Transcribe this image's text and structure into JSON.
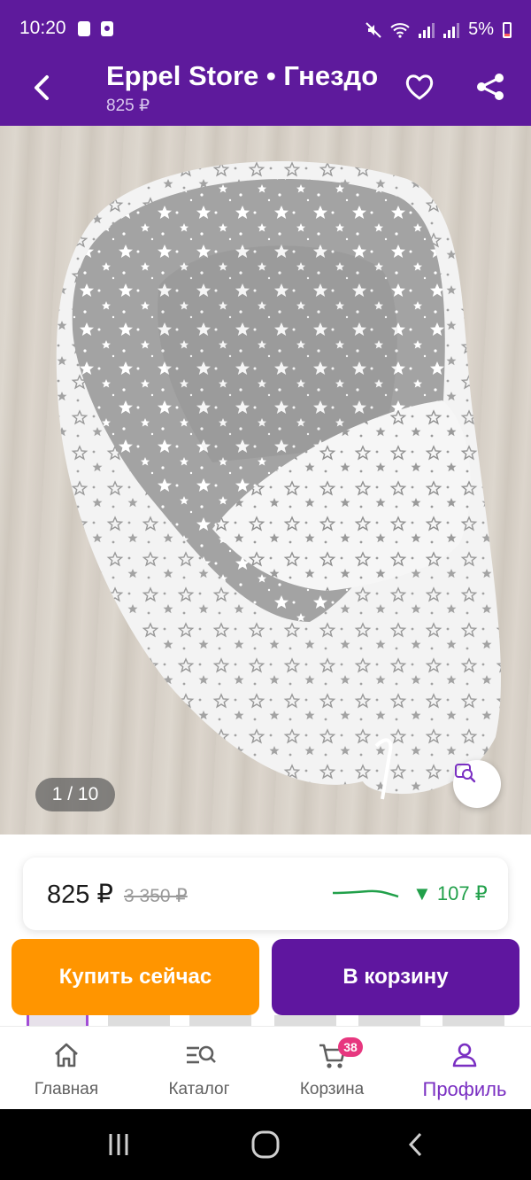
{
  "status_bar": {
    "time": "10:20",
    "battery": "5%"
  },
  "header": {
    "title": "Eppel Store • Гнездо",
    "price": "825 ₽"
  },
  "gallery": {
    "counter": "1 / 10"
  },
  "price_card": {
    "price": "825 ₽",
    "old_price": "3 350 ₽",
    "price_drop": "▼ 107 ₽"
  },
  "actions": {
    "buy_now": "Купить сейчас",
    "add_to_cart": "В корзину"
  },
  "bottom_nav": {
    "items": [
      {
        "label": "Главная",
        "icon": "home-icon"
      },
      {
        "label": "Каталог",
        "icon": "catalog-search-icon"
      },
      {
        "label": "Корзина",
        "icon": "cart-icon",
        "badge": "38"
      },
      {
        "label": "Профиль",
        "icon": "profile-icon",
        "active": true
      }
    ]
  },
  "colors": {
    "brand_purple": "#5e1a9c",
    "buy_orange": "#ff9500",
    "cart_purple": "#5f169f",
    "price_drop_green": "#21a04a",
    "badge_pink": "#e7377f"
  }
}
